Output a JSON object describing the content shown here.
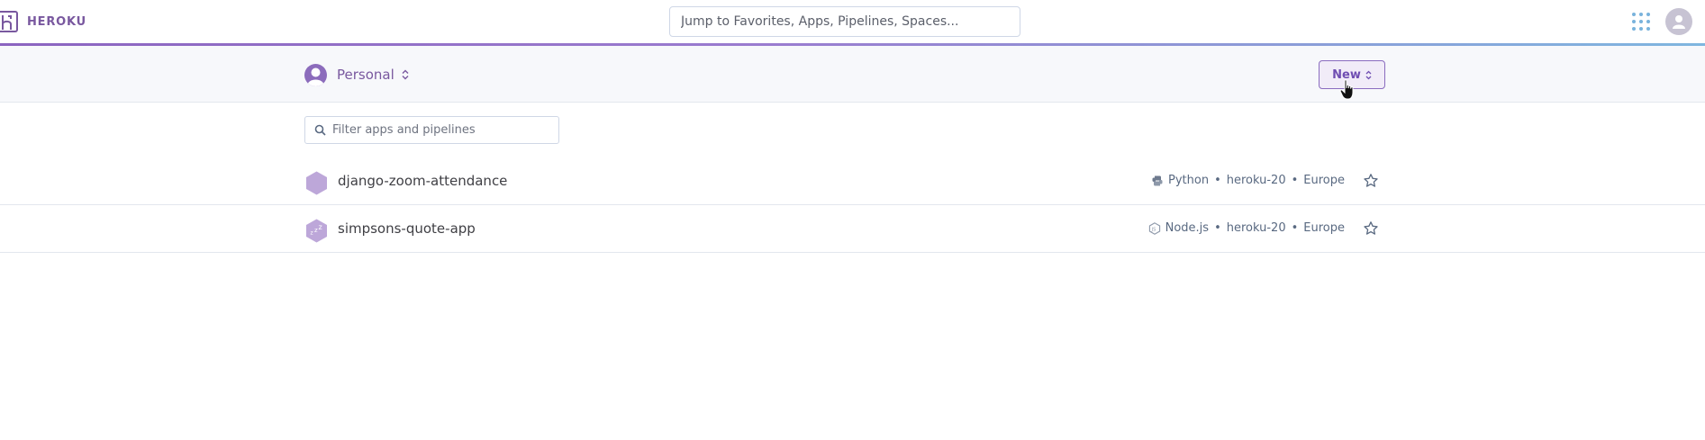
{
  "header": {
    "logo_text": "HEROKU",
    "search_placeholder": "Jump to Favorites, Apps, Pipelines, Spaces...",
    "accent_color": "#79589f"
  },
  "subheader": {
    "account_label": "Personal",
    "new_button_label": "New"
  },
  "filter": {
    "placeholder": "Filter apps and pipelines"
  },
  "apps": [
    {
      "name": "django-zoom-attendance",
      "language": "Python",
      "language_icon": "python-icon",
      "stack": "heroku-20",
      "region": "Europe",
      "status": "active",
      "separator": "•"
    },
    {
      "name": "simpsons-quote-app",
      "language": "Node.js",
      "language_icon": "nodejs-icon",
      "stack": "heroku-20",
      "region": "Europe",
      "status": "sleeping",
      "separator": "•"
    }
  ]
}
